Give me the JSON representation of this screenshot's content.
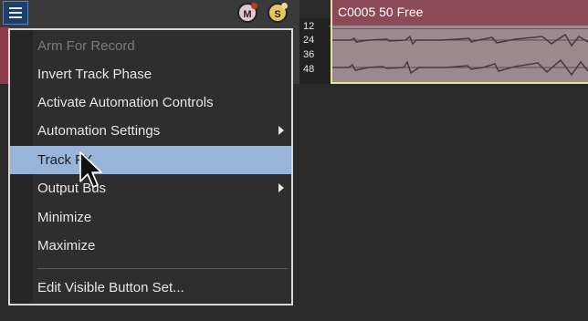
{
  "header": {
    "menu_button_icon": "hamburger-icon",
    "mute_button": "M",
    "solo_button": "S"
  },
  "meter": {
    "labels": [
      "12",
      "24",
      "36",
      "48"
    ]
  },
  "clip": {
    "title": "C0005 50 Free",
    "color": "#8b4a56"
  },
  "menu": {
    "items": [
      {
        "label": "Arm For Record",
        "disabled": true
      },
      {
        "label": "Invert Track Phase"
      },
      {
        "label": "Activate Automation Controls"
      },
      {
        "label": "Automation Settings",
        "submenu": true
      },
      {
        "label": "Track FX",
        "highlighted": true
      },
      {
        "label": "Output Bus",
        "submenu": true
      },
      {
        "label": "Minimize"
      },
      {
        "label": "Maximize"
      },
      {
        "label": "Edit Visible Button Set..."
      }
    ],
    "highlight_color": "#99b4d9"
  },
  "cursor_icon": "mouse-pointer-icon"
}
